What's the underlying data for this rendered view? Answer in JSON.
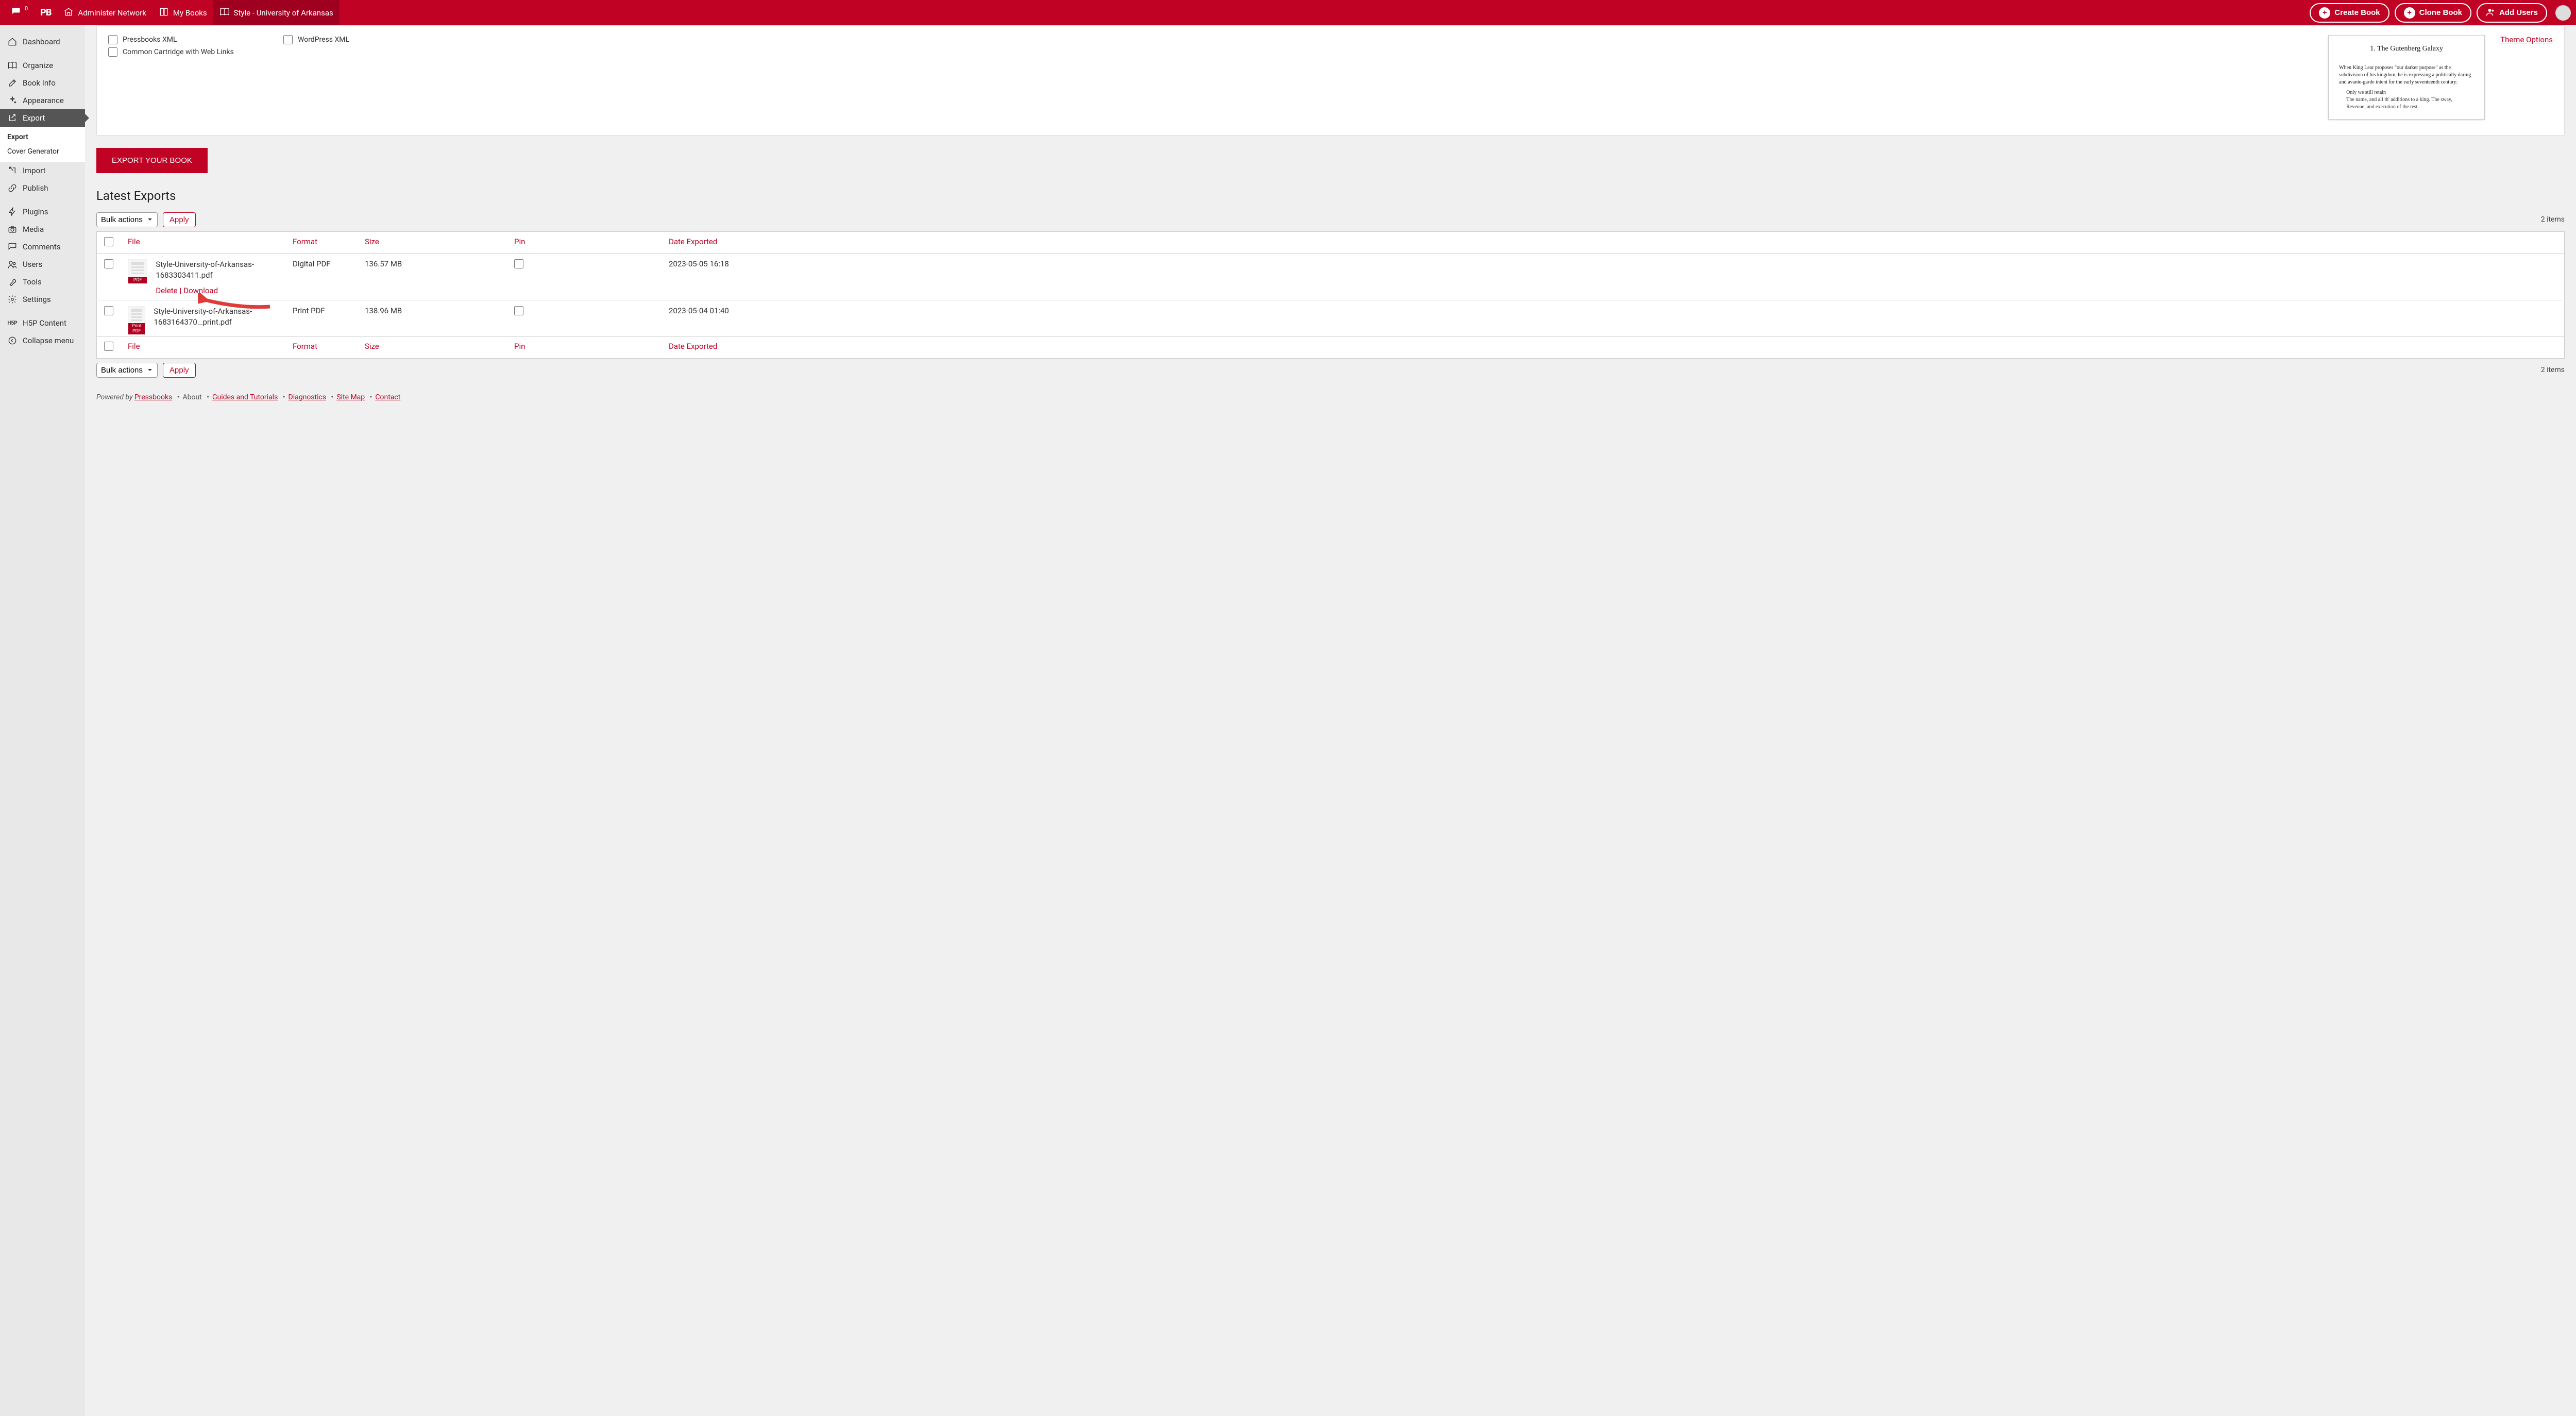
{
  "topbar": {
    "notif_count": "0",
    "logo": "PB",
    "admin_network": "Administer Network",
    "my_books": "My Books",
    "book_title": "Style - University of Arkansas",
    "create_book": "Create Book",
    "clone_book": "Clone Book",
    "add_users": "Add Users"
  },
  "sidebar": {
    "dashboard": "Dashboard",
    "organize": "Organize",
    "book_info": "Book Info",
    "appearance": "Appearance",
    "export": "Export",
    "export_sub": "Export",
    "cover_gen": "Cover Generator",
    "import": "Import",
    "publish": "Publish",
    "plugins": "Plugins",
    "media": "Media",
    "comments": "Comments",
    "users": "Users",
    "tools": "Tools",
    "settings": "Settings",
    "h5p": "H5P Content",
    "collapse": "Collapse menu"
  },
  "options": {
    "pressbooks_xml": "Pressbooks XML",
    "common_cartridge": "Common Cartridge with Web Links",
    "wordpress_xml": "WordPress XML"
  },
  "preview": {
    "heading": "1. The Gutenberg Galaxy",
    "para": "When King Lear proposes \"our darker purpose\" as the subdivision of his kingdom, he is expressing a politically daring and avante-garde intent for the early seventeenth century:",
    "l1": "Only we still retain",
    "l2": "The name, and all th' additions to a king. The sway,",
    "l3": "Revenue, and execution of the rest."
  },
  "theme_options": "Theme Options",
  "export_btn": "EXPORT YOUR BOOK",
  "latest_heading": "Latest Exports",
  "bulk_label": "Bulk actions",
  "apply_label": "Apply",
  "items_count": "2 items",
  "cols": {
    "file": "File",
    "format": "Format",
    "size": "Size",
    "pin": "Pin",
    "date": "Date Exported"
  },
  "rows": [
    {
      "name": "Style-University-of-Arkansas-1683303411.pdf",
      "tag": "PDF",
      "format": "Digital PDF",
      "size": "136.57 MB",
      "date": "2023-05-05 16:18"
    },
    {
      "name": "Style-University-of-Arkansas-1683164370._print.pdf",
      "tag": "Print PDF",
      "format": "Print PDF",
      "size": "138.96 MB",
      "date": "2023-05-04 01:40"
    }
  ],
  "actions": {
    "delete": "Delete",
    "download": "Download"
  },
  "footer": {
    "powered": "Powered by ",
    "pressbooks": "Pressbooks",
    "about": "About",
    "guides": "Guides and Tutorials",
    "diag": "Diagnostics",
    "sitemap": "Site Map",
    "contact": "Contact"
  }
}
